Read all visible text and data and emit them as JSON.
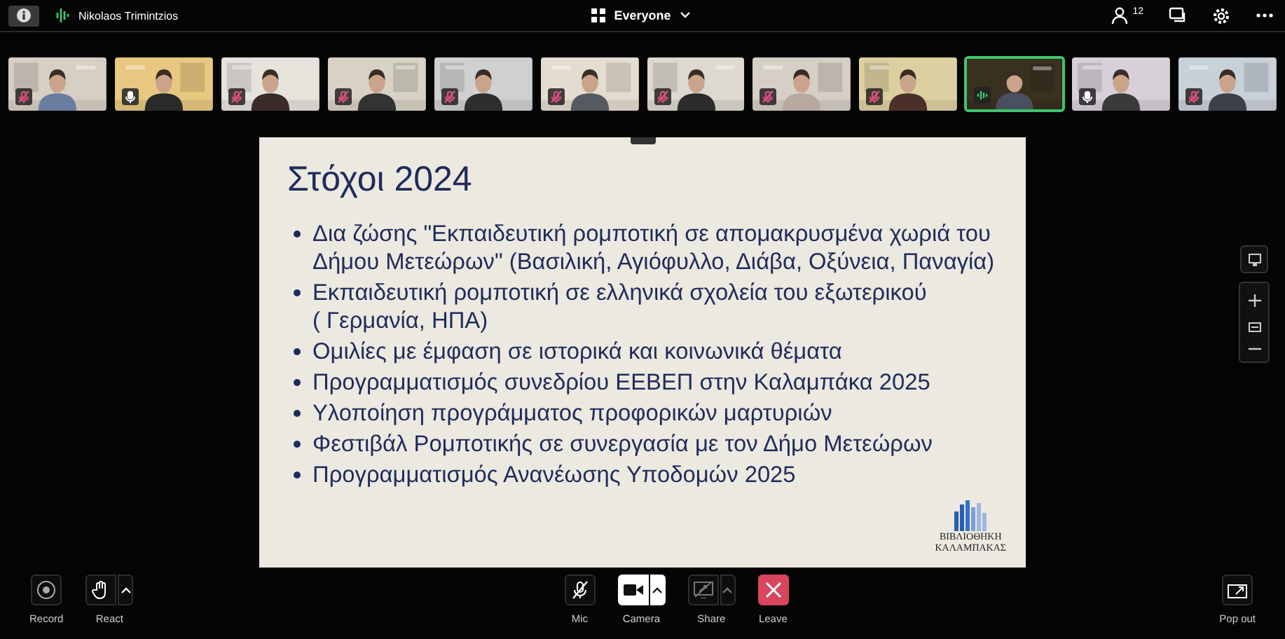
{
  "top_bar": {
    "presenter_name": "Nikolaos Trimintzios",
    "view_label": "Everyone",
    "participant_count": "12"
  },
  "participants": [
    {
      "muted": true,
      "speaking": false
    },
    {
      "muted": false,
      "speaking": false
    },
    {
      "muted": true,
      "speaking": false
    },
    {
      "muted": true,
      "speaking": false
    },
    {
      "muted": true,
      "speaking": false
    },
    {
      "muted": true,
      "speaking": false
    },
    {
      "muted": true,
      "speaking": false
    },
    {
      "muted": true,
      "speaking": false
    },
    {
      "muted": true,
      "speaking": false
    },
    {
      "muted": false,
      "speaking": true
    },
    {
      "muted": false,
      "speaking": false
    },
    {
      "muted": true,
      "speaking": false
    }
  ],
  "slide": {
    "title": "Στόχοι 2024",
    "bullets": [
      [
        "Δια ζώσης \"Εκπαιδευτική ρομποτική σε απομακρυσμένα χωριά του",
        "Δήμου Μετεώρων\" (Βασιλική, Αγιόφυλλο, Διάβα, Οξύνεια, Παναγία)"
      ],
      [
        "Εκπαιδευτική ρομποτική σε ελληνικά σχολεία του εξωτερικού",
        "( Γερμανία, ΗΠΑ)"
      ],
      [
        "Ομιλίες με έμφαση σε ιστορικά και κοινωνικά θέματα"
      ],
      [
        "Προγραμματισμός συνεδρίου ΕΕΒΕΠ στην Καλαμπάκα 2025"
      ],
      [
        "Υλοποίηση προγράμματος προφορικών μαρτυριών"
      ],
      [
        "Φεστιβάλ Ρομποτικής σε συνεργασία με τον Δήμο Μετεώρων"
      ],
      [
        "Προγραμματισμός Ανανέωσης Υποδομών 2025"
      ]
    ],
    "logo_lines": [
      "ΒΙΒΛΙΟΘΗΚΗ",
      "ΚΑΛΑΜΠΑΚΑΣ"
    ]
  },
  "controls": [
    {
      "kind": "record",
      "label": "Record",
      "on": false
    },
    {
      "kind": "react",
      "label": "React",
      "on": false
    },
    {
      "kind": "mic",
      "label": "Mic",
      "on": false
    },
    {
      "kind": "camera",
      "label": "Camera",
      "on": true
    },
    {
      "kind": "share",
      "label": "Share",
      "on": false
    },
    {
      "kind": "leave",
      "label": "Leave",
      "on": false
    },
    {
      "kind": "popout",
      "label": "Pop out",
      "on": false
    }
  ]
}
